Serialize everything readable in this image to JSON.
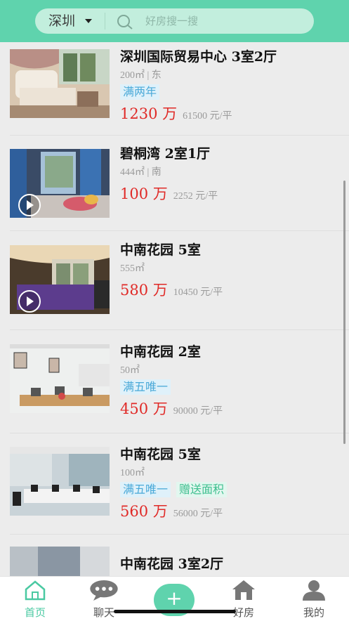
{
  "header": {
    "city": "深圳",
    "search_placeholder": "好房搜一搜"
  },
  "listings": [
    {
      "title": "深圳国际贸易中心 3室2厅",
      "meta": "200㎡ | 东",
      "tags": [
        "满两年"
      ],
      "price": "1230 万",
      "unit_price": "61500 元/平",
      "has_video": false
    },
    {
      "title": "碧桐湾 2室1厅",
      "meta": "444㎡ | 南",
      "tags": [],
      "price": "100 万",
      "unit_price": "2252 元/平",
      "has_video": true
    },
    {
      "title": "中南花园 5室",
      "meta": "555㎡",
      "tags": [],
      "price": "580 万",
      "unit_price": "10450 元/平",
      "has_video": true
    },
    {
      "title": "中南花园 2室",
      "meta": "50㎡",
      "tags": [
        "满五唯一"
      ],
      "price": "450 万",
      "unit_price": "90000 元/平",
      "has_video": false
    },
    {
      "title": "中南花园 5室",
      "meta": "100㎡",
      "tags": [
        "满五唯一",
        "赠送面积"
      ],
      "price": "560 万",
      "unit_price": "56000 元/平",
      "has_video": false
    },
    {
      "title": "中南花园 3室2厅",
      "meta": "",
      "tags": [],
      "price": "",
      "unit_price": "",
      "has_video": false
    }
  ],
  "tabbar": {
    "home": "首页",
    "chat": "聊天",
    "add": "+",
    "houses": "好房",
    "me": "我的"
  },
  "colors": {
    "brand": "#5fd3ad",
    "price": "#e02a27"
  }
}
